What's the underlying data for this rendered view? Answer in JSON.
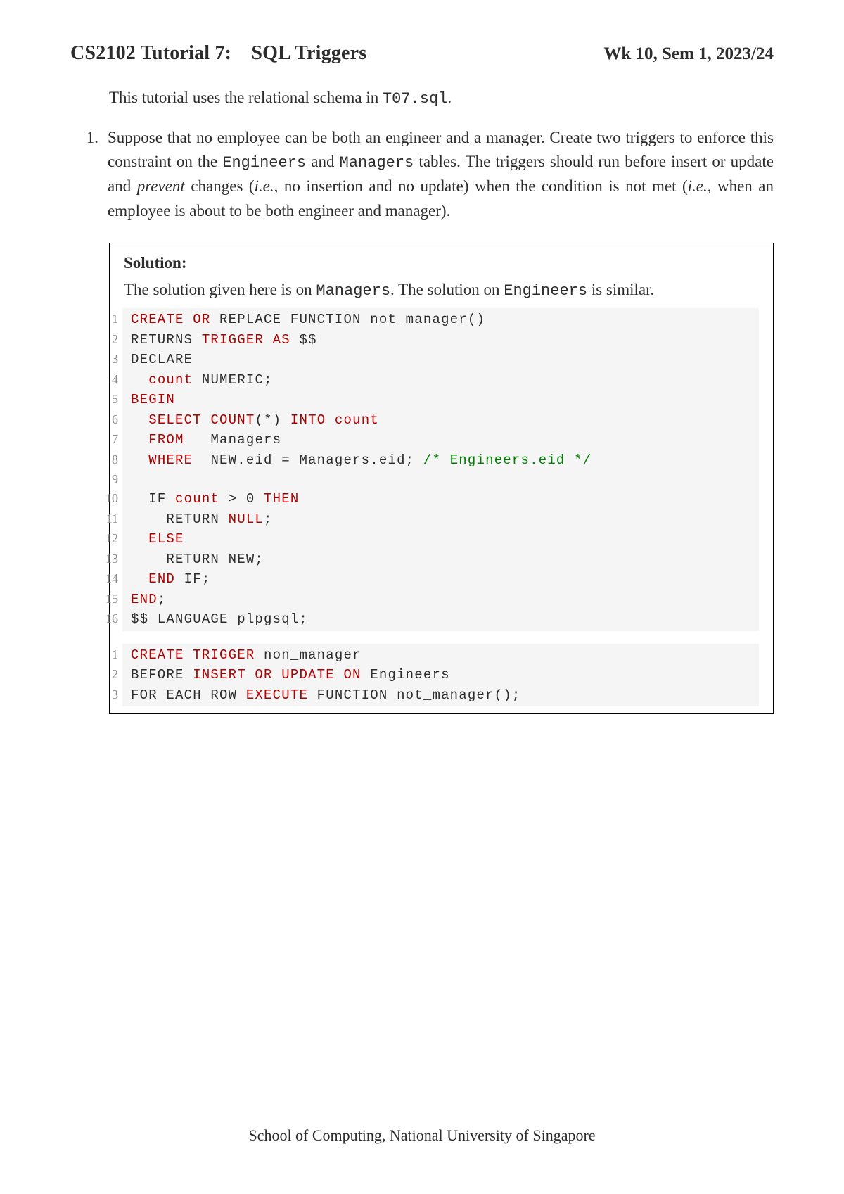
{
  "header": {
    "title_left": "CS2102 Tutorial 7: SQL Triggers",
    "title_right": "Wk 10, Sem 1, 2023/24"
  },
  "intro": {
    "pre": "This tutorial uses the relational schema in ",
    "file": "T07.sql",
    "post": "."
  },
  "question": {
    "number": "1.",
    "p1": "Suppose that no employee can be both an engineer and a manager.  Create two triggers to enforce this constraint on the ",
    "c1": "Engineers",
    "p2": " and ",
    "c2": "Managers",
    "p3": " tables. The triggers should run before insert or update and ",
    "i1": "prevent",
    "p4": " changes (",
    "i2": "i.e.",
    "p5": ", no insertion and no update) when the condition is not met (",
    "i3": "i.e.",
    "p6": ", when an employee is about to be both engineer and manager)."
  },
  "solution": {
    "heading": "Solution:",
    "t1": "The solution given here is on ",
    "tc1": "Managers",
    "t2": ".  The solution on ",
    "tc2": "Engineers",
    "t3": " is similar."
  },
  "code1": [
    {
      "n": "1",
      "tokens": [
        {
          "t": "CREATE OR",
          "c": "kw"
        },
        {
          "t": " REPLACE FUNCTION not_manager()"
        }
      ]
    },
    {
      "n": "2",
      "tokens": [
        {
          "t": "RETURNS "
        },
        {
          "t": "TRIGGER AS",
          "c": "kw"
        },
        {
          "t": " $$"
        }
      ]
    },
    {
      "n": "3",
      "tokens": [
        {
          "t": "DECLARE"
        }
      ]
    },
    {
      "n": "4",
      "tokens": [
        {
          "t": "  "
        },
        {
          "t": "count",
          "c": "kw"
        },
        {
          "t": " NUMERIC;"
        }
      ]
    },
    {
      "n": "5",
      "tokens": [
        {
          "t": "BEGIN",
          "c": "kw"
        }
      ]
    },
    {
      "n": "6",
      "tokens": [
        {
          "t": "  "
        },
        {
          "t": "SELECT",
          "c": "kw"
        },
        {
          "t": " "
        },
        {
          "t": "COUNT",
          "c": "kw"
        },
        {
          "t": "(*) "
        },
        {
          "t": "INTO",
          "c": "kw"
        },
        {
          "t": " "
        },
        {
          "t": "count",
          "c": "kw"
        }
      ]
    },
    {
      "n": "7",
      "tokens": [
        {
          "t": "  "
        },
        {
          "t": "FROM",
          "c": "kw"
        },
        {
          "t": "   Managers"
        }
      ]
    },
    {
      "n": "8",
      "tokens": [
        {
          "t": "  "
        },
        {
          "t": "WHERE",
          "c": "kw"
        },
        {
          "t": "  NEW.eid = Managers.eid; "
        },
        {
          "t": "/* Engineers.eid */",
          "c": "cm"
        }
      ]
    },
    {
      "n": "9",
      "tokens": [
        {
          "t": ""
        }
      ]
    },
    {
      "n": "10",
      "tokens": [
        {
          "t": "  IF "
        },
        {
          "t": "count",
          "c": "kw"
        },
        {
          "t": " > 0 "
        },
        {
          "t": "THEN",
          "c": "kw"
        }
      ]
    },
    {
      "n": "11",
      "tokens": [
        {
          "t": "    RETURN "
        },
        {
          "t": "NULL",
          "c": "kw"
        },
        {
          "t": ";"
        }
      ]
    },
    {
      "n": "12",
      "tokens": [
        {
          "t": "  "
        },
        {
          "t": "ELSE",
          "c": "kw"
        }
      ]
    },
    {
      "n": "13",
      "tokens": [
        {
          "t": "    RETURN NEW;"
        }
      ]
    },
    {
      "n": "14",
      "tokens": [
        {
          "t": "  "
        },
        {
          "t": "END",
          "c": "kw"
        },
        {
          "t": " IF;"
        }
      ]
    },
    {
      "n": "15",
      "tokens": [
        {
          "t": "END",
          "c": "kw"
        },
        {
          "t": ";"
        }
      ]
    },
    {
      "n": "16",
      "tokens": [
        {
          "t": "$$ LANGUAGE plpgsql;"
        }
      ]
    }
  ],
  "code2": [
    {
      "n": "1",
      "tokens": [
        {
          "t": "CREATE TRIGGER",
          "c": "kw"
        },
        {
          "t": " non_manager"
        }
      ]
    },
    {
      "n": "2",
      "tokens": [
        {
          "t": "BEFORE "
        },
        {
          "t": "INSERT OR UPDATE ON",
          "c": "kw"
        },
        {
          "t": " Engineers"
        }
      ]
    },
    {
      "n": "3",
      "tokens": [
        {
          "t": "FOR EACH ROW "
        },
        {
          "t": "EXECUTE",
          "c": "kw"
        },
        {
          "t": " FUNCTION not_manager();"
        }
      ]
    }
  ],
  "footer": "School of Computing, National University of Singapore"
}
